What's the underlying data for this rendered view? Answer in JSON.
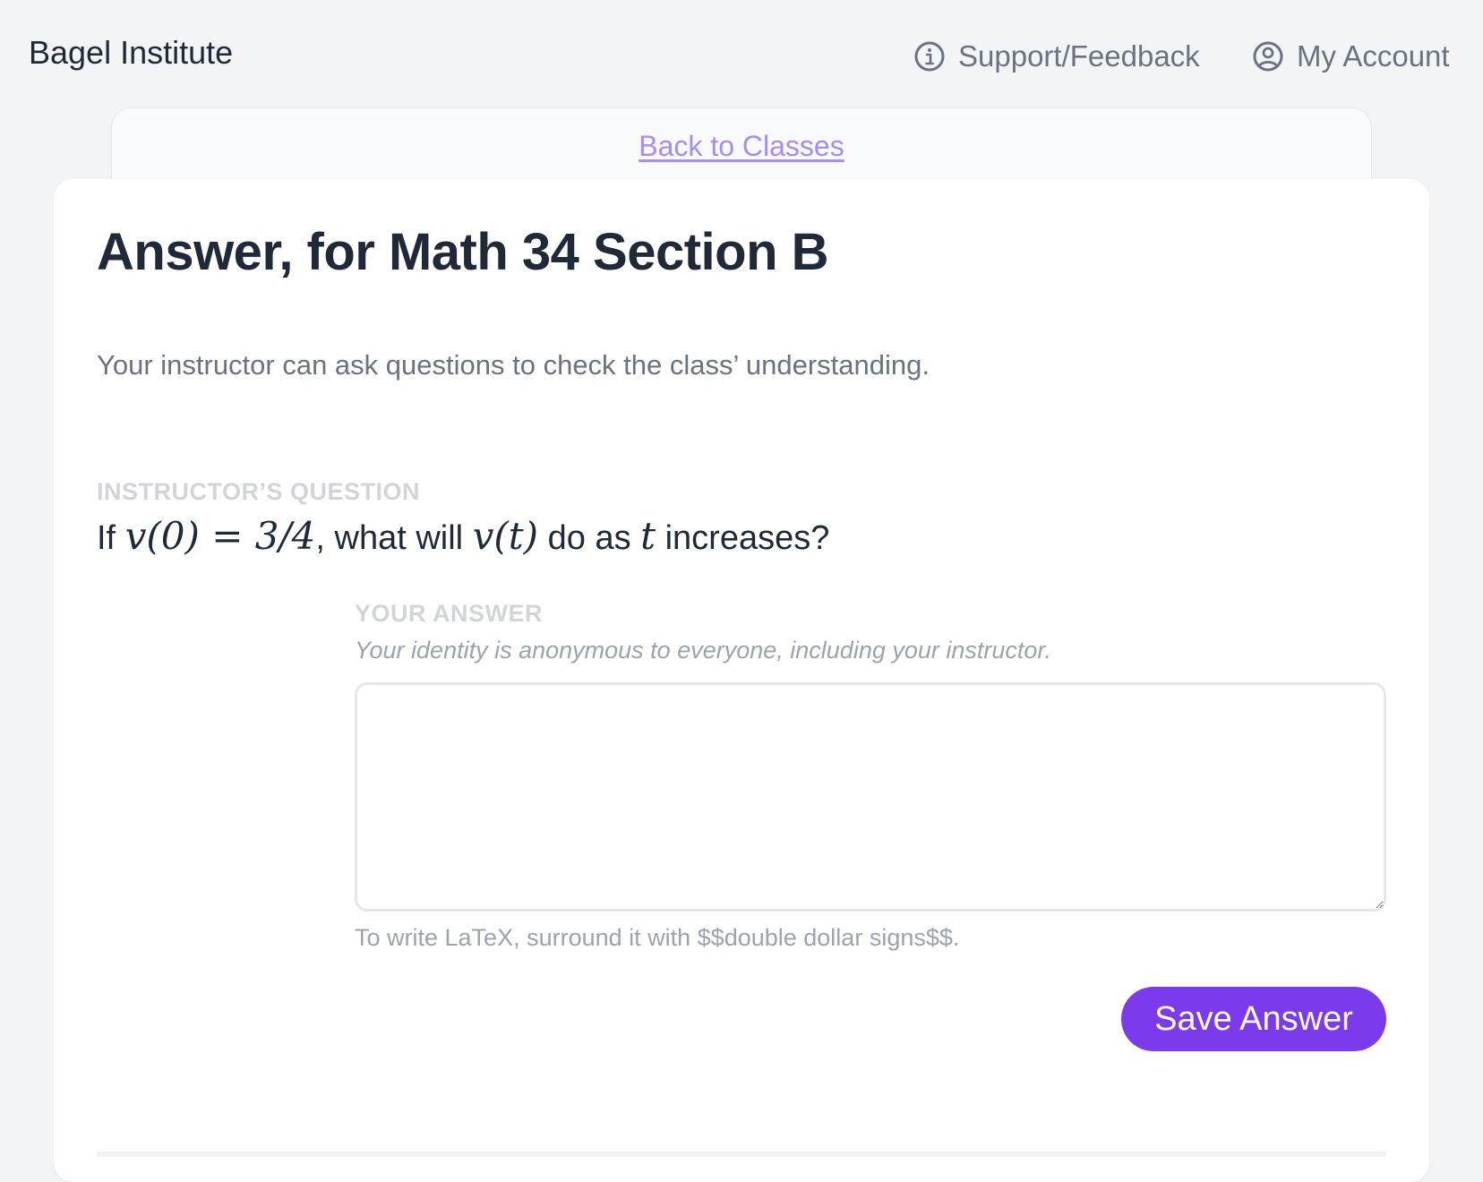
{
  "header": {
    "brand": "Bagel Institute",
    "support_label": "Support/Feedback",
    "account_label": "My Account"
  },
  "back_link": "Back to Classes",
  "main": {
    "title": "Answer, for Math 34 Section B",
    "subtitle": "Your instructor can ask questions to check the class’ understanding.",
    "question_label": "INSTRUCTOR’S QUESTION",
    "question": {
      "prefix": "If ",
      "math1": "v(0) = 3/4",
      "mid1": ", what will ",
      "math2": "v(t)",
      "mid2": " do as ",
      "math3": "t",
      "suffix": " increases?"
    },
    "answer_label": "YOUR ANSWER",
    "answer_hint": "Your identity is anonymous to everyone, including your instructor.",
    "answer_value": "",
    "latex_hint": "To write LaTeX, surround it with $$double dollar signs$$.",
    "save_label": "Save Answer"
  },
  "colors": {
    "accent": "#7c3aed",
    "link": "#a78bfa",
    "background": "#f3f4f6"
  },
  "icons": {
    "support": "info-circle-icon",
    "account": "user-circle-icon"
  }
}
